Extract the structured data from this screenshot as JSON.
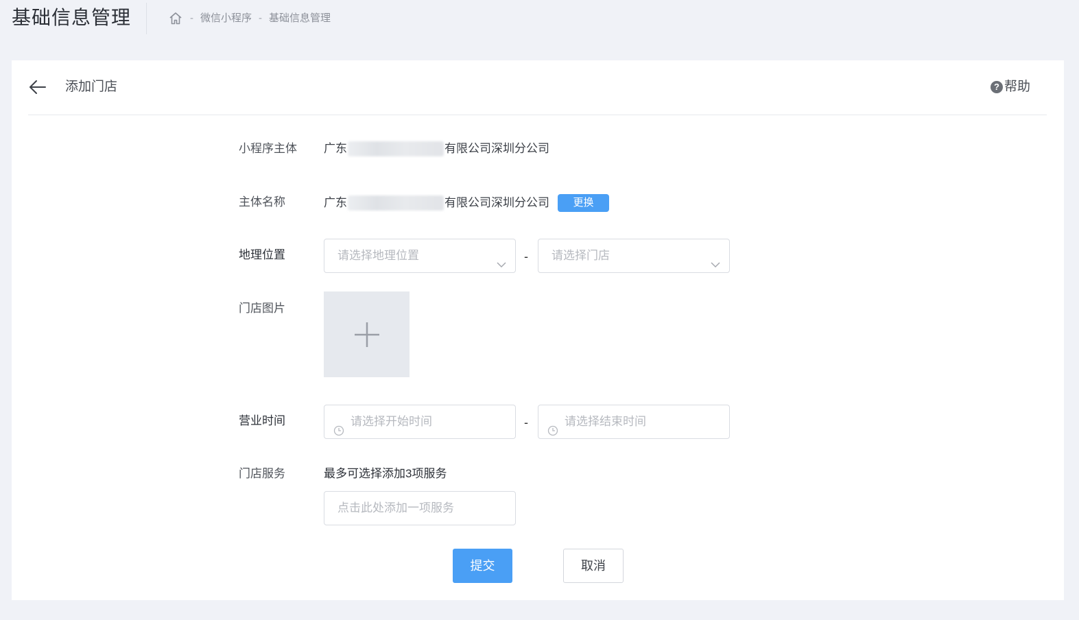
{
  "header": {
    "title": "基础信息管理",
    "breadcrumb": {
      "home_icon": "home-icon",
      "separator": "-",
      "items": [
        "微信小程序",
        "基础信息管理"
      ]
    }
  },
  "card": {
    "back_icon": "arrow-left-icon",
    "title": "添加门店",
    "help_icon": "question-circle-icon",
    "help_label": "帮助"
  },
  "form": {
    "subject": {
      "label": "小程序主体",
      "value_prefix": "广东",
      "value_suffix": "有限公司深圳分公司"
    },
    "entity_name": {
      "label": "主体名称",
      "value_prefix": "广东",
      "value_suffix": "有限公司深圳分公司",
      "change_button": "更换"
    },
    "location": {
      "label": "地理位置",
      "region_placeholder": "请选择地理位置",
      "store_placeholder": "请选择门店",
      "separator": "-"
    },
    "images": {
      "label": "门店图片",
      "upload_icon": "plus-icon"
    },
    "hours": {
      "label": "营业时间",
      "start_placeholder": "请选择开始时间",
      "end_placeholder": "请选择结束时间",
      "separator": "-",
      "icon": "clock-icon"
    },
    "services": {
      "label": "门店服务",
      "hint": "最多可选择添加3项服务",
      "placeholder": "点击此处添加一项服务"
    }
  },
  "actions": {
    "submit": "提交",
    "cancel": "取消"
  },
  "colors": {
    "primary": "#4a9ff5",
    "background": "#f0f2f7",
    "card": "#ffffff",
    "upload_bg": "#e6e9ee"
  }
}
